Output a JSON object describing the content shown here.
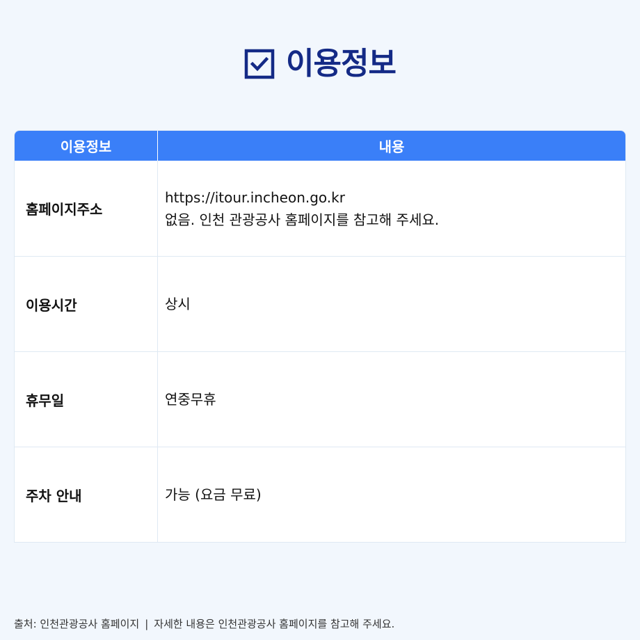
{
  "header": {
    "title": "이용정보",
    "icon": "checkbox-checked-icon",
    "title_color": "#142a86"
  },
  "table": {
    "header_color": "#3a7ff8",
    "columns": [
      "이용정보",
      "내용"
    ],
    "rows": [
      {
        "label": "홈페이지주소",
        "lines": [
          "https://itour.incheon.go.kr",
          "없음. 인천 관광공사 홈페이지를 참고해 주세요."
        ]
      },
      {
        "label": "이용시간",
        "lines": [
          "상시"
        ]
      },
      {
        "label": "휴무일",
        "lines": [
          "연중무휴"
        ]
      },
      {
        "label": "주차 안내",
        "lines": [
          "가능 (요금 무료)"
        ]
      }
    ]
  },
  "footer": {
    "source": "출처: 인천관광공사 홈페이지",
    "separator": "|",
    "note": "자세한 내용은 인천관광공사 홈페이지를 참고해 주세요."
  }
}
